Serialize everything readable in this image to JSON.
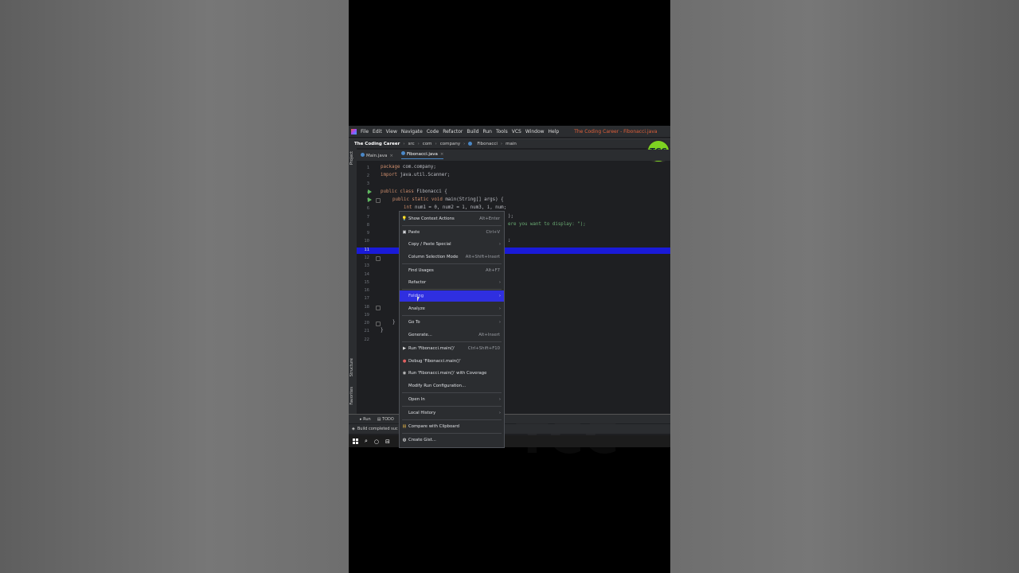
{
  "menubar": {
    "items": [
      "File",
      "Edit",
      "View",
      "Navigate",
      "Code",
      "Refactor",
      "Build",
      "Run",
      "Tools",
      "VCS",
      "Window",
      "Help"
    ],
    "title": "The Coding Career - Fibonacci.java"
  },
  "navbar": {
    "project": "The Coding Career",
    "crumbs": [
      "src",
      "com",
      "company",
      "Fibonacci",
      "main"
    ]
  },
  "badge": "TCC",
  "watermark": "TCC",
  "tool_strip": {
    "project": "Project",
    "structure": "Structure",
    "favorites": "Favorites"
  },
  "tabs": [
    {
      "label": "Main.java",
      "active": false
    },
    {
      "label": "Fibonacci.java",
      "active": true
    }
  ],
  "editor": {
    "line_numbers": [
      "1",
      "2",
      "3",
      "4",
      "5",
      "6",
      "7",
      "8",
      "9",
      "10",
      "11",
      "12",
      "13",
      "14",
      "15",
      "16",
      "17",
      "18",
      "19",
      "20",
      "21",
      "22"
    ],
    "current_line": "11",
    "code": {
      "l1_kw": "package",
      "l1_rest": " com.company;",
      "l2_kw": "import",
      "l2_rest": " java.util.Scanner;",
      "l4_kw": "public class",
      "l4_rest": " Fibonacci {",
      "l5_kw": "public static void",
      "l5_rest": " main(String[] args) {",
      "l6_kw": "int",
      "l6_rest": " num1 = 0, num2 = 1, num3, i, num;",
      "l7": ");",
      "l8_str": "ere you want to display: \");",
      "l10": ";",
      "l20": "}",
      "l21": "}"
    }
  },
  "context_menu": {
    "items": [
      {
        "label": "Show Context Actions",
        "shortcut": "Alt+Enter",
        "icon": "lightbulb-icon"
      },
      {
        "label": "Paste",
        "shortcut": "Ctrl+V",
        "icon": "clipboard-icon"
      },
      {
        "label": "Copy / Paste Special",
        "shortcut": "",
        "submenu": true
      },
      {
        "label": "Column Selection Mode",
        "shortcut": "Alt+Shift+Insert"
      },
      {
        "label": "Find Usages",
        "shortcut": "Alt+F7"
      },
      {
        "label": "Refactor",
        "shortcut": "",
        "submenu": true
      },
      {
        "label": "Folding",
        "shortcut": "",
        "submenu": true,
        "highlighted": true
      },
      {
        "label": "Analyze",
        "shortcut": "",
        "submenu": true
      },
      {
        "label": "Go To",
        "shortcut": "",
        "submenu": true
      },
      {
        "label": "Generate...",
        "shortcut": "Alt+Insert"
      },
      {
        "label": "Run 'Fibonacci.main()'",
        "shortcut": "Ctrl+Shift+F10",
        "icon": "run-icon"
      },
      {
        "label": "Debug 'Fibonacci.main()'",
        "shortcut": "",
        "icon": "debug-icon"
      },
      {
        "label": "Run 'Fibonacci.main()' with Coverage",
        "shortcut": "",
        "icon": "coverage-icon"
      },
      {
        "label": "Modify Run Configuration...",
        "shortcut": ""
      },
      {
        "label": "Open In",
        "shortcut": "",
        "submenu": true
      },
      {
        "label": "Local History",
        "shortcut": "",
        "submenu": true
      },
      {
        "label": "Compare with Clipboard",
        "shortcut": "",
        "icon": "compare-icon"
      },
      {
        "label": "Create Gist...",
        "shortcut": "",
        "icon": "github-icon"
      }
    ]
  },
  "bottom_tools": {
    "run": "Run",
    "todo": "TODO"
  },
  "status": {
    "text": "Build completed suc"
  },
  "colors": {
    "accent": "#2f2fe0",
    "current_line": "#1a1ad8",
    "badge": "#7ed321",
    "title": "#e0603a"
  }
}
